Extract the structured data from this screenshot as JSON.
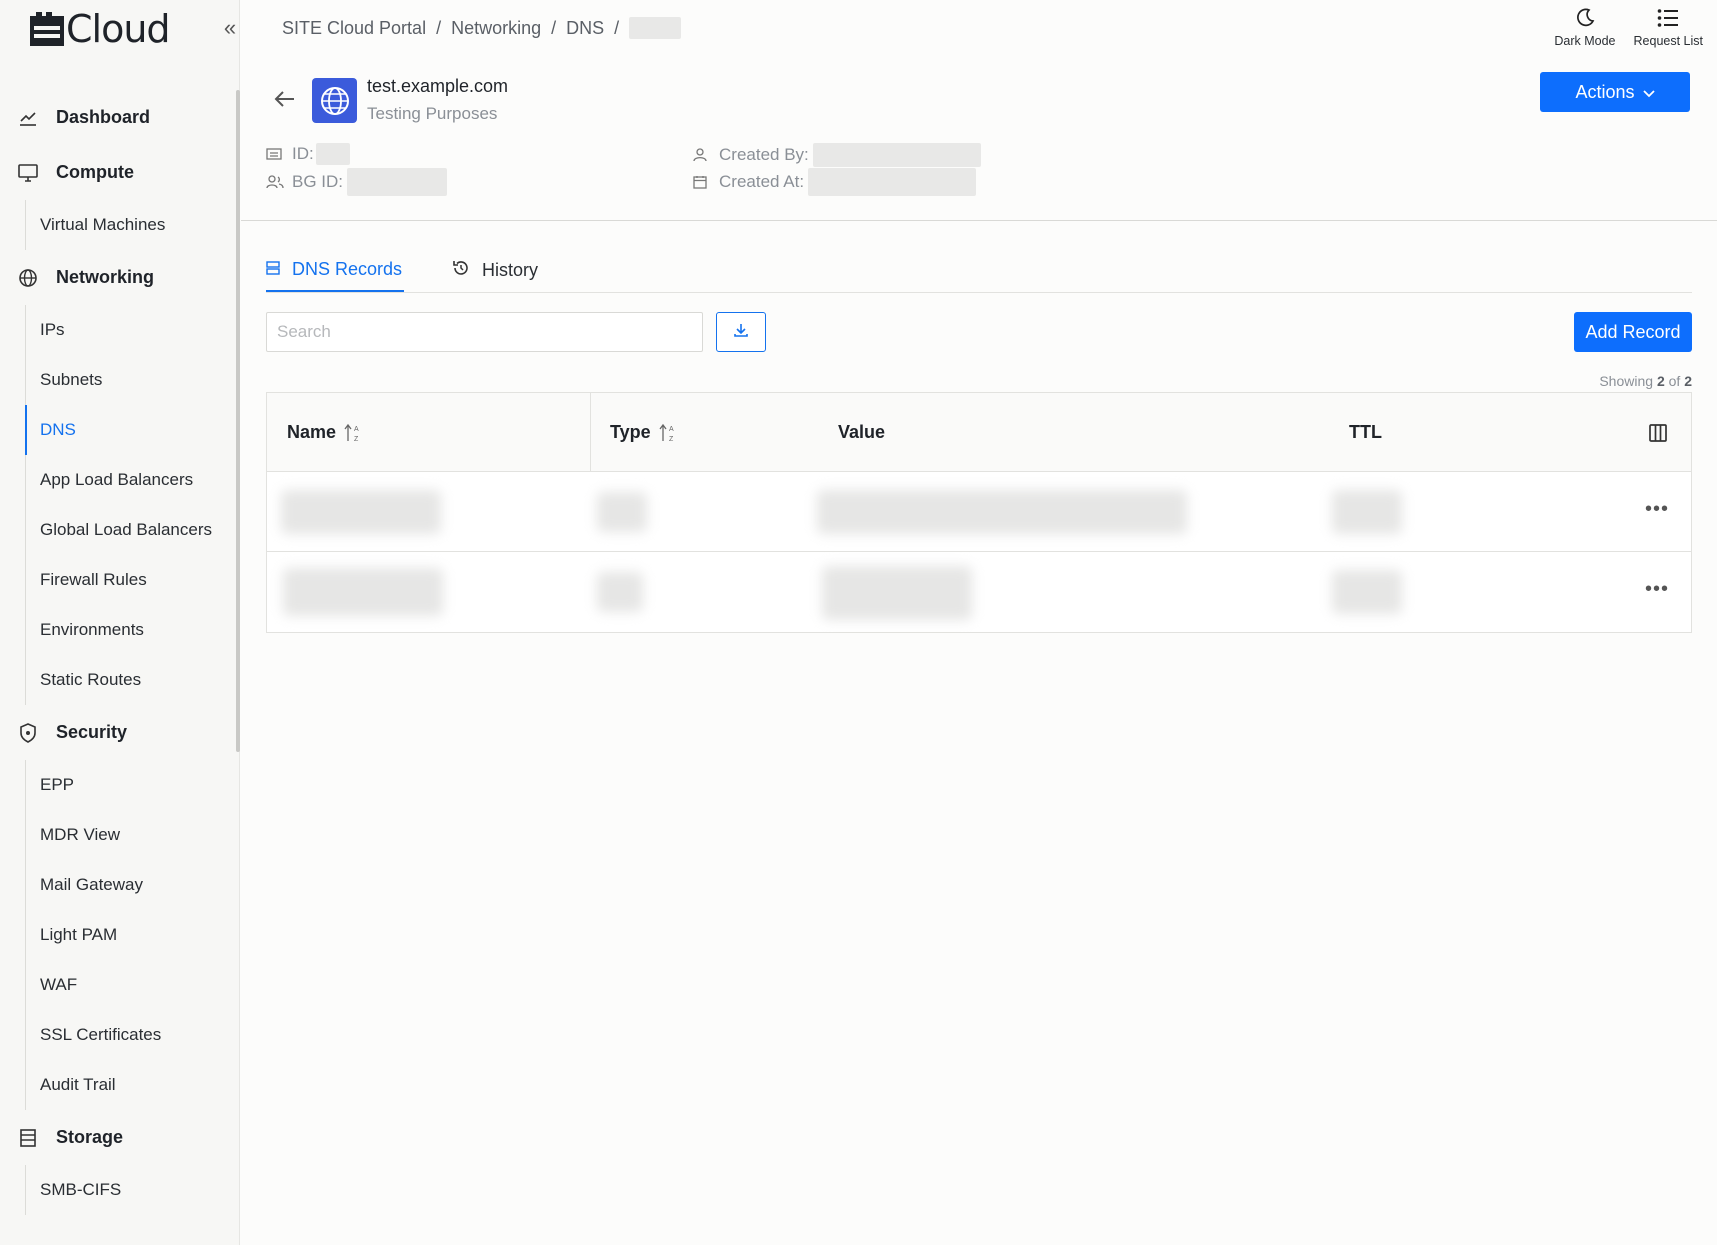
{
  "brand": {
    "name": "Cloud"
  },
  "header": {
    "breadcrumb": [
      "SITE Cloud Portal",
      "Networking",
      "DNS"
    ],
    "dark_mode_label": "Dark Mode",
    "request_list_label": "Request List"
  },
  "sidebar": {
    "sections": [
      {
        "label": "Dashboard",
        "icon": "chart-line-icon",
        "items": []
      },
      {
        "label": "Compute",
        "icon": "monitor-icon",
        "items": [
          "Virtual Machines"
        ]
      },
      {
        "label": "Networking",
        "icon": "globe-icon",
        "items": [
          "IPs",
          "Subnets",
          "DNS",
          "App Load Balancers",
          "Global Load Balancers",
          "Firewall Rules",
          "Environments",
          "Static Routes"
        ]
      },
      {
        "label": "Security",
        "icon": "shield-icon",
        "items": [
          "EPP",
          "MDR View",
          "Mail Gateway",
          "Light PAM",
          "WAF",
          "SSL Certificates",
          "Audit Trail"
        ]
      },
      {
        "label": "Storage",
        "icon": "storage-icon",
        "items": [
          "SMB-CIFS"
        ]
      }
    ],
    "active_item": "DNS"
  },
  "resource": {
    "title": "test.example.com",
    "subtitle": "Testing Purposes",
    "actions_label": "Actions",
    "meta": {
      "id_label": "ID:",
      "bg_id_label": "BG ID:",
      "created_by_label": "Created By:",
      "created_at_label": "Created At:"
    }
  },
  "tabs": [
    {
      "label": "DNS Records",
      "active": true
    },
    {
      "label": "History",
      "active": false
    }
  ],
  "toolbar": {
    "search_placeholder": "Search",
    "add_label": "Add Record",
    "showing_prefix": "Showing",
    "showing_count": "2",
    "showing_of": "of",
    "showing_total": "2"
  },
  "table": {
    "columns": [
      "Name",
      "Type",
      "Value",
      "TTL"
    ],
    "rows_count": 2
  },
  "colors": {
    "accent": "#0d6efd",
    "link": "#1472ee",
    "resource_icon": "#3b5bdb"
  }
}
